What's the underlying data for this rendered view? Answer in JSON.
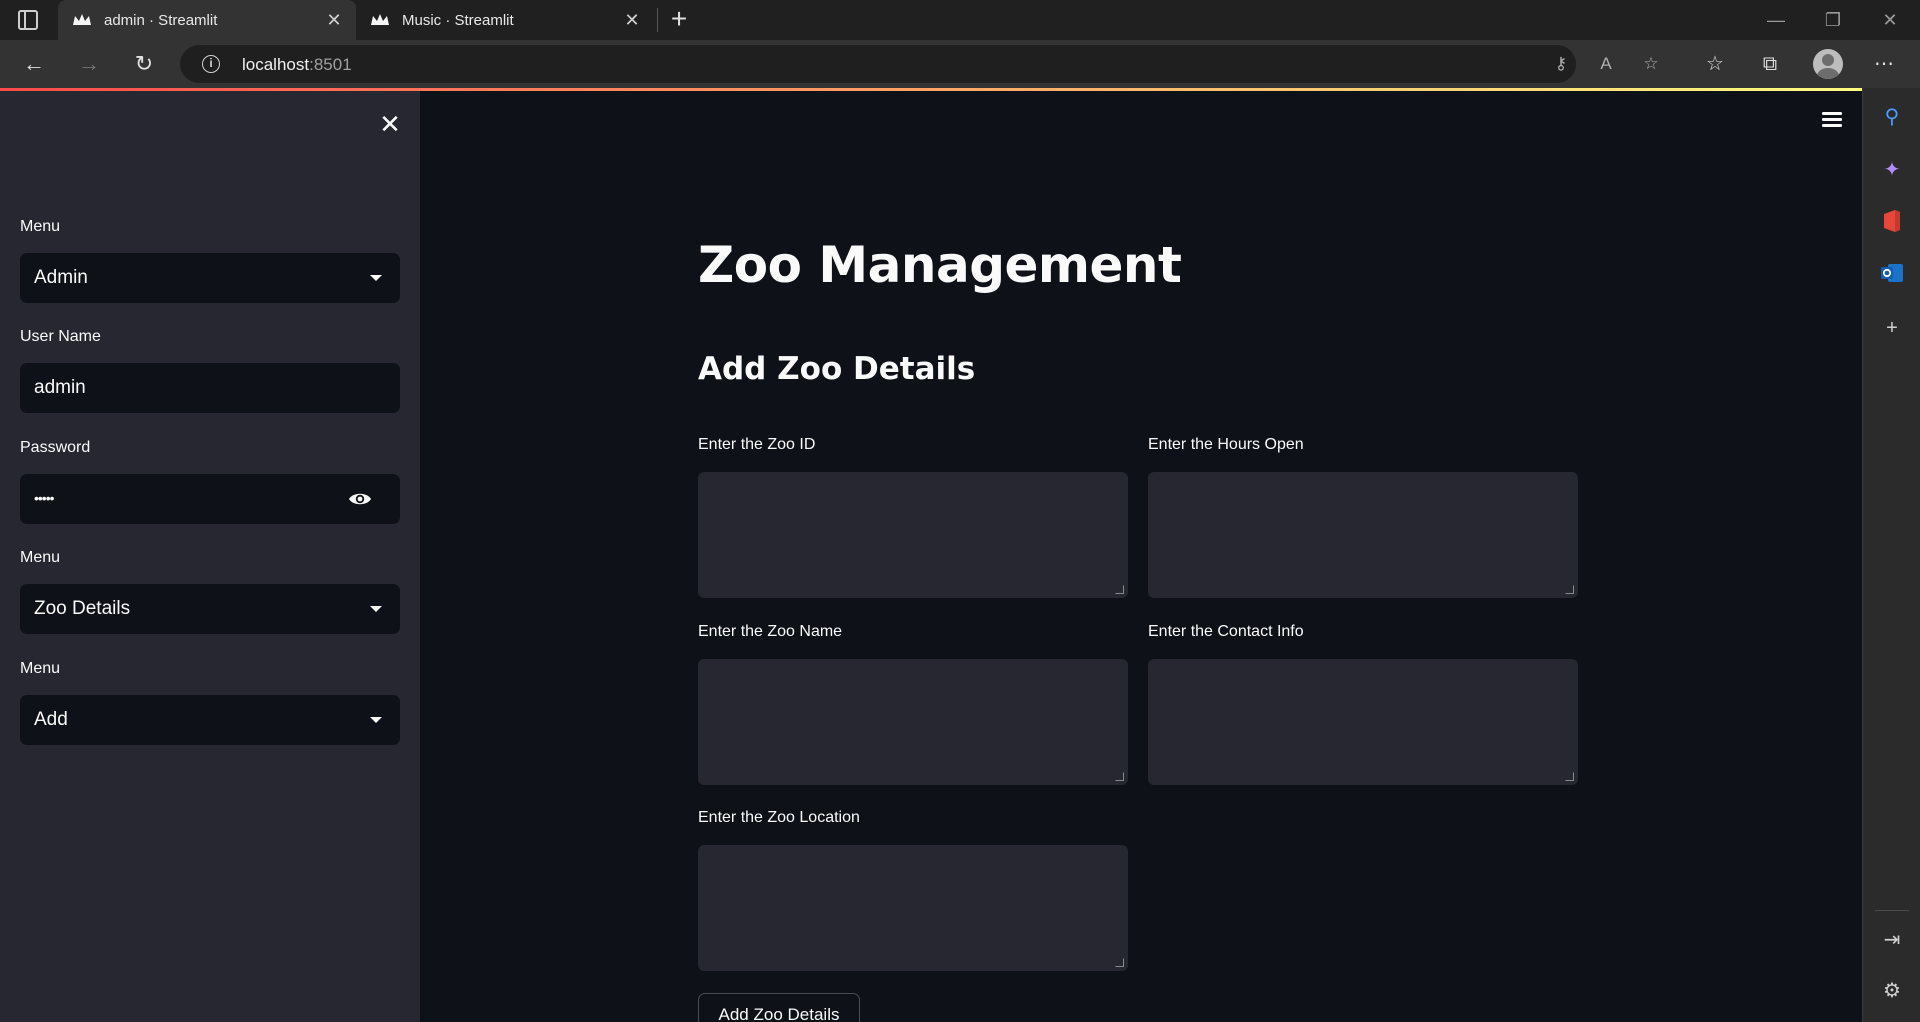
{
  "browser": {
    "tabs": [
      {
        "title": "admin · Streamlit",
        "active": true
      },
      {
        "title": "Music · Streamlit",
        "active": false
      }
    ],
    "url_host": "localhost",
    "url_port": ":8501"
  },
  "sidebar": {
    "role_menu": {
      "label": "Menu",
      "value": "Admin"
    },
    "username": {
      "label": "User Name",
      "value": "admin"
    },
    "password": {
      "label": "Password",
      "masked": "•••••"
    },
    "section_menu": {
      "label": "Menu",
      "value": "Zoo Details"
    },
    "action_menu": {
      "label": "Menu",
      "value": "Add"
    }
  },
  "main": {
    "title": "Zoo Management",
    "subtitle": "Add Zoo Details",
    "fields": {
      "zoo_id": "Enter the Zoo ID",
      "hours_open": "Enter the Hours Open",
      "zoo_name": "Enter the Zoo Name",
      "contact_info": "Enter the Contact Info",
      "zoo_location": "Enter the Zoo Location"
    },
    "submit_label": "Add Zoo Details"
  },
  "colors": {
    "accent": "#ff4b4b",
    "background": "#0e1117",
    "sidebar": "#262730"
  }
}
